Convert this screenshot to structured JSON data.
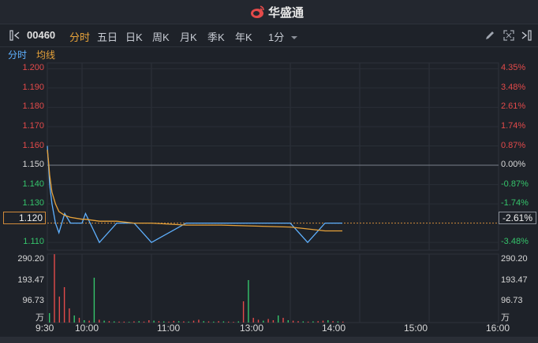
{
  "brand": {
    "name": "华盛通"
  },
  "toolbar": {
    "stock_code": "00460",
    "tabs": [
      "分时",
      "五日",
      "日K",
      "周K",
      "月K",
      "季K",
      "年K"
    ],
    "active_tab": "分时",
    "interval": "1分"
  },
  "subtabs": {
    "intraday": "分时",
    "avg_line": "均线"
  },
  "current": {
    "price": "1.120",
    "pct": "-2.61%"
  },
  "price_axis_left": [
    {
      "label": "1.200",
      "tone": "red"
    },
    {
      "label": "1.190",
      "tone": "red"
    },
    {
      "label": "1.180",
      "tone": "red"
    },
    {
      "label": "1.170",
      "tone": "red"
    },
    {
      "label": "1.160",
      "tone": "red"
    },
    {
      "label": "1.150",
      "tone": "white"
    },
    {
      "label": "1.140",
      "tone": "green"
    },
    {
      "label": "1.130",
      "tone": "green"
    },
    {
      "label": "1.110",
      "tone": "green"
    }
  ],
  "price_axis_right": [
    {
      "label": "4.35%",
      "tone": "red"
    },
    {
      "label": "3.48%",
      "tone": "red"
    },
    {
      "label": "2.61%",
      "tone": "red"
    },
    {
      "label": "1.74%",
      "tone": "red"
    },
    {
      "label": "0.87%",
      "tone": "red"
    },
    {
      "label": "0.00%",
      "tone": "white"
    },
    {
      "label": "-0.87%",
      "tone": "green"
    },
    {
      "label": "-1.74%",
      "tone": "green"
    },
    {
      "label": "-3.48%",
      "tone": "green"
    }
  ],
  "volume_axis": {
    "labels": [
      "290.20",
      "193.47",
      "96.73"
    ],
    "unit": "万"
  },
  "time_axis": [
    "9:30",
    "10:00",
    "11:00",
    "13:00",
    "14:00",
    "15:00",
    "16:00"
  ],
  "colors": {
    "up": "#e34a4a",
    "down": "#35c46b",
    "price_line": "#5fb1ff",
    "avg_line": "#e8a33a"
  },
  "chart_data": {
    "type": "line",
    "prev_close": 1.15,
    "ylim": [
      1.106,
      1.203
    ],
    "x": [
      "9:30",
      "9:31",
      "9:32",
      "9:34",
      "9:37",
      "9:40",
      "9:45",
      "9:50",
      "10:00",
      "10:03",
      "10:15",
      "10:30",
      "10:45",
      "11:00",
      "11:30",
      "12:00",
      "13:00",
      "13:15",
      "13:30",
      "13:45"
    ],
    "series": [
      {
        "name": "分时",
        "values": [
          1.16,
          1.15,
          1.14,
          1.13,
          1.12,
          1.115,
          1.125,
          1.12,
          1.12,
          1.125,
          1.11,
          1.12,
          1.12,
          1.11,
          1.12,
          1.12,
          1.12,
          1.11,
          1.12,
          1.12
        ]
      },
      {
        "name": "均线",
        "values": [
          1.158,
          1.152,
          1.145,
          1.136,
          1.13,
          1.126,
          1.124,
          1.123,
          1.122,
          1.122,
          1.121,
          1.121,
          1.12,
          1.12,
          1.119,
          1.119,
          1.118,
          1.117,
          1.116,
          1.116
        ]
      }
    ],
    "volume": {
      "ylim": [
        0,
        290.2
      ],
      "values": [
        40,
        290,
        110,
        150,
        60,
        30,
        20,
        10,
        8,
        190,
        12,
        8,
        6,
        5,
        4,
        4,
        3,
        5,
        6,
        4,
        10,
        8,
        6,
        5,
        4,
        7,
        6,
        5,
        4,
        8,
        12,
        6,
        5,
        4,
        6,
        5,
        4,
        3,
        5,
        90,
        180,
        20,
        12,
        8,
        15,
        10,
        30,
        20,
        10,
        8,
        6,
        5,
        4,
        5,
        6,
        8,
        10,
        6,
        5,
        4
      ],
      "up": [
        false,
        true,
        true,
        true,
        true,
        false,
        true,
        false,
        true,
        false,
        true,
        false,
        true,
        false,
        true,
        true,
        false,
        true,
        false,
        true,
        true,
        false,
        true,
        false,
        true,
        true,
        false,
        true,
        false,
        true,
        true,
        false,
        true,
        false,
        true,
        false,
        true,
        true,
        false,
        true,
        false,
        true,
        true,
        false,
        true,
        true,
        false,
        true,
        false,
        true,
        true,
        false,
        true,
        false,
        true,
        true,
        false,
        true,
        false,
        true
      ]
    }
  }
}
